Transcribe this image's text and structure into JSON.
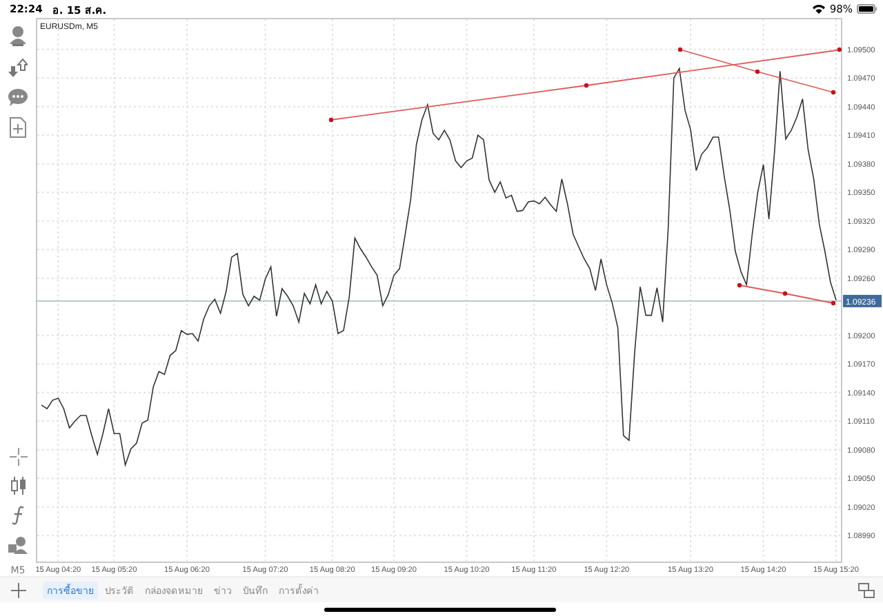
{
  "status_bar": {
    "time": "22:24",
    "date": "อ. 15 ส.ค.",
    "battery": "98%"
  },
  "toolbar": {
    "timeframe": "M5"
  },
  "chart": {
    "title": "EURUSDm, M5",
    "chart_data": {
      "type": "line",
      "categories": [
        null,
        null,
        null,
        "15 Aug 04:20",
        null,
        null,
        null,
        null,
        null,
        null,
        null,
        null,
        null,
        "15 Aug 05:20",
        null,
        null,
        null,
        null,
        null,
        null,
        null,
        null,
        null,
        null,
        null,
        null,
        "15 Aug 06:20",
        null,
        null,
        null,
        null,
        null,
        null,
        null,
        null,
        null,
        null,
        null,
        null,
        null,
        "15 Aug 07:20",
        null,
        null,
        null,
        null,
        null,
        null,
        null,
        null,
        null,
        null,
        null,
        "15 Aug 08:20",
        null,
        null,
        null,
        null,
        null,
        null,
        null,
        null,
        null,
        null,
        "15 Aug 09:20",
        null,
        null,
        null,
        null,
        null,
        null,
        null,
        null,
        null,
        null,
        null,
        null,
        "15 Aug 10:20",
        null,
        null,
        null,
        null,
        null,
        null,
        null,
        null,
        null,
        null,
        null,
        "15 Aug 11:20",
        null,
        null,
        null,
        null,
        null,
        null,
        null,
        null,
        null,
        null,
        null,
        null,
        "15 Aug 12:20",
        null,
        null,
        null,
        null,
        null,
        null,
        null,
        null,
        null,
        null,
        null,
        null,
        null,
        null,
        "15 Aug 13:20",
        null,
        null,
        null,
        null,
        null,
        null,
        null,
        null,
        null,
        null,
        null,
        null,
        "15 Aug 14:20",
        null,
        null,
        null,
        null,
        null,
        null,
        null,
        null,
        null,
        null,
        null,
        null,
        "15 Aug 15:20"
      ],
      "series": [
        {
          "color": "#333333",
          "values": [
            1.09127,
            1.09123,
            1.09132,
            1.09134,
            1.09123,
            1.09103,
            1.0911,
            1.09116,
            1.09116,
            1.09095,
            1.09075,
            1.09097,
            1.09123,
            1.09097,
            1.09097,
            1.09064,
            1.09081,
            1.09087,
            1.09108,
            1.09111,
            1.09146,
            1.09162,
            1.09159,
            1.09179,
            1.09184,
            1.09205,
            1.09201,
            1.09202,
            1.09194,
            1.09217,
            1.09231,
            1.09238,
            1.09223,
            1.09246,
            1.09282,
            1.09286,
            1.09243,
            1.09231,
            1.09241,
            1.09237,
            1.09259,
            1.09272,
            1.0922,
            1.09249,
            1.09241,
            1.09231,
            1.09214,
            1.09244,
            1.09233,
            1.09253,
            1.09233,
            1.09246,
            1.09236,
            1.09202,
            1.09205,
            1.0924,
            1.09302,
            1.09291,
            1.09282,
            1.09272,
            1.09263,
            1.09231,
            1.09243,
            1.09263,
            1.0927,
            1.09306,
            1.09343,
            1.094,
            1.09426,
            1.09442,
            1.09412,
            1.09405,
            1.09415,
            1.09405,
            1.09383,
            1.09376,
            1.09383,
            1.09386,
            1.0941,
            1.09405,
            1.09363,
            1.0935,
            1.09361,
            1.09344,
            1.09347,
            1.0933,
            1.09331,
            1.0934,
            1.09341,
            1.09338,
            1.09345,
            1.09337,
            1.0933,
            1.09364,
            1.09338,
            1.09306,
            1.09293,
            1.0928,
            1.0927,
            1.09247,
            1.0928,
            1.09253,
            1.09234,
            1.09208,
            1.09095,
            1.0909,
            1.09182,
            1.09251,
            1.09221,
            1.09221,
            1.0925,
            1.09214,
            1.09312,
            1.0947,
            1.0948,
            1.09436,
            1.09416,
            1.09373,
            1.0939,
            1.09397,
            1.09408,
            1.09408,
            1.09367,
            1.09332,
            1.09288,
            1.09267,
            1.09253,
            1.09306,
            1.0935,
            1.09379,
            1.09322,
            1.09393,
            1.09477,
            1.09406,
            1.09415,
            1.09429,
            1.09448,
            1.09395,
            1.09364,
            1.09317,
            1.09288,
            1.09256,
            1.09237
          ]
        }
      ],
      "ylim": [
        1.08962,
        1.09533
      ],
      "grid": true,
      "ref_lines": [
        {
          "axis": "y",
          "value": 1.09236,
          "label": "1.09236"
        }
      ],
      "yticks": [
        {
          "value": 1.095,
          "label": "1.09500"
        },
        {
          "value": 1.0947,
          "label": "1.09470"
        },
        {
          "value": 1.0944,
          "label": "1.09440"
        },
        {
          "value": 1.0941,
          "label": "1.09410"
        },
        {
          "value": 1.0938,
          "label": "1.09380"
        },
        {
          "value": 1.0935,
          "label": "1.09350"
        },
        {
          "value": 1.0932,
          "label": "1.09320"
        },
        {
          "value": 1.0929,
          "label": "1.09290"
        },
        {
          "value": 1.0926,
          "label": "1.09260"
        },
        {
          "value": 1.092,
          "label": "1.09200"
        },
        {
          "value": 1.0917,
          "label": "1.09170"
        },
        {
          "value": 1.0914,
          "label": "1.09140"
        },
        {
          "value": 1.0911,
          "label": "1.09110"
        },
        {
          "value": 1.0908,
          "label": "1.09080"
        },
        {
          "value": 1.0905,
          "label": "1.09050"
        },
        {
          "value": 1.0902,
          "label": "1.09020"
        },
        {
          "value": 1.0899,
          "label": "1.08990"
        }
      ]
    },
    "drawings": [
      {
        "kind": "trendline"
      },
      {
        "kind": "trendline"
      },
      {
        "kind": "trendline"
      }
    ]
  },
  "tabs": [
    {
      "label": "การซื้อขาย",
      "selected": true
    },
    {
      "label": "ประวัติ",
      "selected": false
    },
    {
      "label": "กล่องจดหมาย",
      "selected": false
    },
    {
      "label": "ข่าว",
      "selected": false
    },
    {
      "label": "บันทึก",
      "selected": false
    },
    {
      "label": "การตั้งค่า",
      "selected": false
    }
  ]
}
